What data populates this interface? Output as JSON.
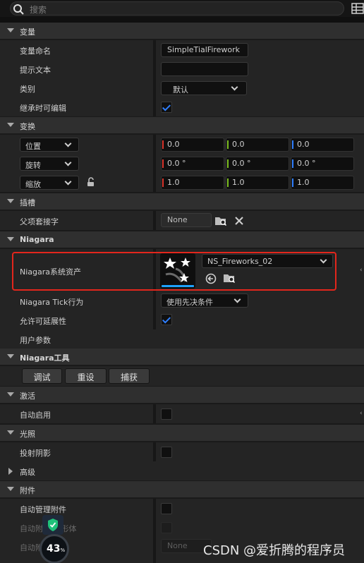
{
  "search": {
    "placeholder": "搜索"
  },
  "categories": {
    "variable": "变量",
    "transform": "变换",
    "socket": "插槽",
    "niagara": "Niagara",
    "niagara_tools": "Niagara工具",
    "activation": "激活",
    "lighting": "光照",
    "advanced": "高级",
    "attachment": "附件"
  },
  "variable": {
    "name_label": "变量命名",
    "name_value": "SimpleTialFirework",
    "tooltip_label": "提示文本",
    "tooltip_value": "",
    "category_label": "类别",
    "category_value": "默认",
    "editable_label": "继承时可编辑",
    "editable_checked": true
  },
  "transform": {
    "location": {
      "mode": "位置",
      "x": "0.0",
      "y": "0.0",
      "z": "0.0"
    },
    "rotation": {
      "mode": "旋转",
      "x": "0.0 °",
      "y": "0.0 °",
      "z": "0.0 °"
    },
    "scale": {
      "mode": "缩放",
      "x": "1.0",
      "y": "1.0",
      "z": "1.0"
    }
  },
  "socket": {
    "parent_label": "父项套接字",
    "parent_value": "None"
  },
  "niagara": {
    "asset_label": "Niagara系统资产",
    "asset_value": "NS_Fireworks_02",
    "tick_label": "Niagara Tick行为",
    "tick_value": "使用先决条件",
    "scalability_label": "允许可延展性",
    "scalability_checked": true,
    "user_params_label": "用户参数"
  },
  "niagara_tools": {
    "debug": "调试",
    "reset": "重设",
    "capture": "捕获"
  },
  "activation": {
    "auto_activate_label": "自动启用"
  },
  "lighting": {
    "cast_shadow_label": "投射阴影"
  },
  "attachment": {
    "auto_manage_label": "自动管理附件",
    "row2_label": "自动附 模拟形体",
    "row3_label": "自动附 名称",
    "row3_value": "None"
  },
  "overlay": {
    "watermark": "CSDN @爱折腾的程序员",
    "gauge_value": "43",
    "gauge_unit": "%"
  },
  "colors": {
    "x_axis": "#d9342b",
    "y_axis": "#7cbd1f",
    "z_axis": "#2f7fff",
    "checkbox_check": "#2f7fff",
    "highlight_border": "#e3261c",
    "thumb_bar": "#1ea2ff"
  }
}
